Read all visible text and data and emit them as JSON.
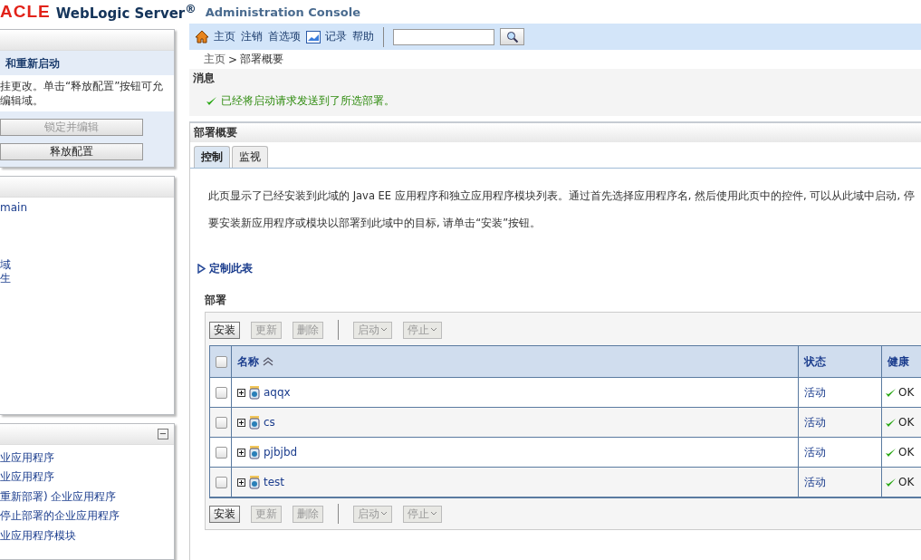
{
  "header": {
    "brand": "ACLE",
    "product": "WebLogic Server",
    "product_mark": "®",
    "subtitle": "Administration Console"
  },
  "change_center": {
    "title": "和重新启动",
    "message": [
      "挂更改。单击“释放配置”按钮可允",
      "编辑域。"
    ],
    "buttons": [
      {
        "label": "锁定并编辑",
        "disabled": true
      },
      {
        "label": "释放配置",
        "disabled": false
      }
    ]
  },
  "domain_tree": {
    "items": [
      "main",
      "域",
      "生"
    ]
  },
  "how_do_i": {
    "collapse": "−",
    "items": [
      "业应用程序",
      "业应用程序",
      "重新部署) 企业应用程序",
      "停止部署的企业应用程序",
      "业应用程序模块"
    ]
  },
  "toolbar": {
    "links": [
      {
        "kind": "home",
        "label": "主页"
      },
      {
        "kind": "plain",
        "label": "注销"
      },
      {
        "kind": "plain",
        "label": "首选项"
      },
      {
        "kind": "chart",
        "label": "记录"
      },
      {
        "kind": "plain",
        "label": "帮助"
      }
    ]
  },
  "breadcrumb": {
    "home": "主页",
    "separator": ">",
    "current": "部署概要"
  },
  "messages": {
    "title": "消息",
    "items": [
      "已经将启动请求发送到了所选部署。"
    ]
  },
  "summary": {
    "title": "部署概要",
    "tabs": [
      {
        "label": "控制",
        "selected": true
      },
      {
        "label": "监视",
        "selected": false
      }
    ],
    "intro": [
      "此页显示了已经安装到此域的 Java EE 应用程序和独立应用程序模块列表。通过首先选择应用程序名, 然后使用此页中的控件, 可以从此域中启动, 停",
      "要安装新应用程序或模块以部署到此域中的目标, 请单击“安装”按钮。"
    ],
    "customize": "定制此表",
    "table_title": "部署",
    "actions": [
      {
        "label": "安装",
        "disabled": false,
        "menu": false
      },
      {
        "label": "更新",
        "disabled": true,
        "menu": false
      },
      {
        "label": "删除",
        "disabled": true,
        "menu": false
      },
      {
        "label": "启动",
        "disabled": true,
        "menu": true
      },
      {
        "label": "停止",
        "disabled": true,
        "menu": true
      }
    ],
    "bottom_actions": [
      {
        "label": "安装",
        "disabled": false,
        "menu": false
      },
      {
        "label": "更新",
        "disabled": true,
        "menu": false
      },
      {
        "label": "删除",
        "disabled": true,
        "menu": false
      },
      {
        "label": "启动",
        "disabled": true,
        "menu": true
      },
      {
        "label": "停止",
        "disabled": true,
        "menu": true
      }
    ],
    "select_all": {
      "checked": false
    },
    "columns": [
      "名称",
      "状态",
      "健康"
    ],
    "rows": [
      {
        "name": "aqqx",
        "checked": false,
        "state": "活动",
        "health": "OK"
      },
      {
        "name": "cs",
        "checked": false,
        "state": "活动",
        "health": "OK"
      },
      {
        "name": "pjbjbd",
        "checked": false,
        "state": "活动",
        "health": "OK"
      },
      {
        "name": "test",
        "checked": false,
        "state": "活动",
        "health": "OK"
      }
    ]
  }
}
